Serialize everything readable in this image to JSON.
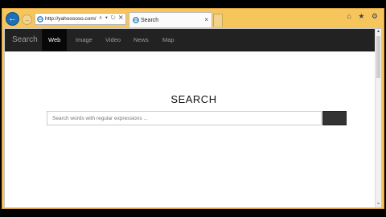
{
  "browser": {
    "url": "http://yahoososo.com/",
    "address_tools": "⌕ ▾ ↻ ✕",
    "tab": {
      "title": "Search",
      "close": "×"
    },
    "right_icons": "⌂ ★ ⚙",
    "back_glyph": "←",
    "forward_glyph": "→"
  },
  "site": {
    "brand": "Search",
    "nav": [
      {
        "label": "Web",
        "active": true
      },
      {
        "label": "Image",
        "active": false
      },
      {
        "label": "Video",
        "active": false
      },
      {
        "label": "News",
        "active": false
      },
      {
        "label": "Map",
        "active": false
      }
    ],
    "heading": "SEARCH",
    "search": {
      "placeholder": "Search words with regular expressions ...",
      "value": ""
    }
  },
  "colors": {
    "window_frame": "#f6c65c",
    "navbar": "#222222",
    "active_nav": "#080808",
    "search_button": "#333333",
    "back_button": "#1d6fb6"
  },
  "icons": [
    "back-arrow-icon",
    "forward-arrow-icon",
    "ie-page-icon",
    "search-icon",
    "refresh-icon",
    "close-icon",
    "home-icon",
    "favorites-star-icon",
    "settings-gear-icon"
  ]
}
